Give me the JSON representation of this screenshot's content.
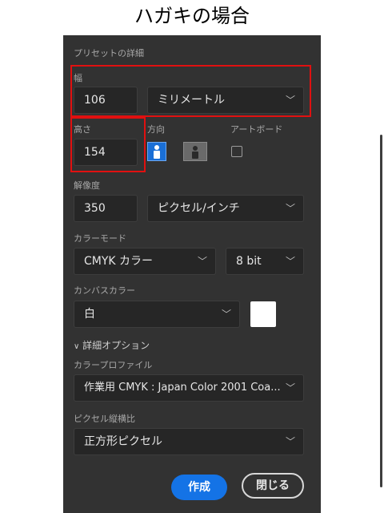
{
  "page_title": "ハガキの場合",
  "panel": {
    "section_title": "プリセットの詳細",
    "width": {
      "label": "幅",
      "value": "106",
      "unit": "ミリメートル"
    },
    "height": {
      "label": "高さ",
      "value": "154"
    },
    "orientation": {
      "label": "方向",
      "selected": "portrait"
    },
    "artboard": {
      "label": "アートボード",
      "checked": false
    },
    "resolution": {
      "label": "解像度",
      "value": "350",
      "unit": "ピクセル/インチ"
    },
    "color_mode": {
      "label": "カラーモード",
      "mode": "CMYK カラー",
      "depth": "8 bit"
    },
    "canvas_color": {
      "label": "カンバスカラー",
      "value": "白",
      "swatch": "#ffffff"
    },
    "advanced": {
      "label": "詳細オプション"
    },
    "color_profile": {
      "label": "カラープロファイル",
      "value": "作業用 CMYK : Japan Color 2001 Coa..."
    },
    "pixel_aspect": {
      "label": "ピクセル縦横比",
      "value": "正方形ピクセル"
    },
    "buttons": {
      "create": "作成",
      "close": "閉じる"
    }
  },
  "colors": {
    "panel_bg": "#323232",
    "field_bg": "#262626",
    "accent": "#1473e6",
    "highlight": "#e01010"
  },
  "icons": {
    "dropdown": "chevron-down-icon",
    "portrait": "portrait-icon",
    "landscape": "landscape-icon"
  }
}
